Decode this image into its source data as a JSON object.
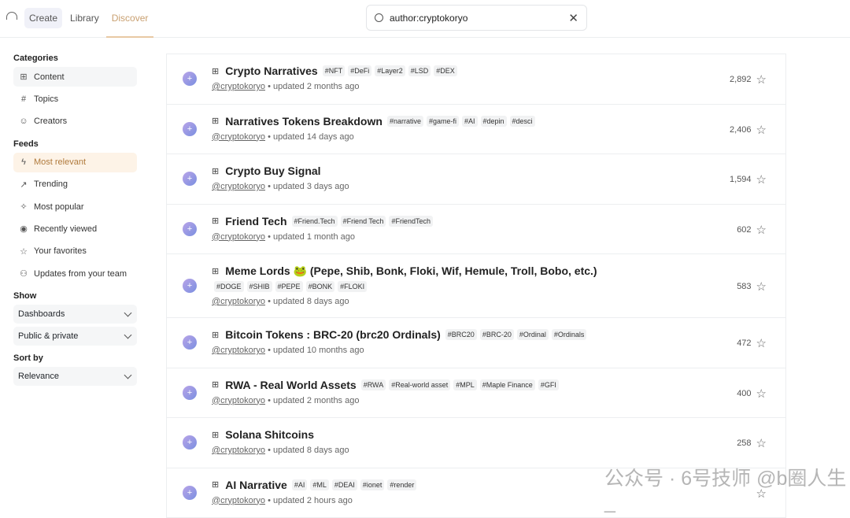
{
  "nav": {
    "tabs": [
      "Create",
      "Library",
      "Discover"
    ]
  },
  "search": {
    "value": "author:cryptokoryo"
  },
  "sidebar": {
    "categories_title": "Categories",
    "categories": [
      {
        "label": "Content",
        "icon": "grid-icon"
      },
      {
        "label": "Topics",
        "icon": "hash-icon"
      },
      {
        "label": "Creators",
        "icon": "user-icon"
      }
    ],
    "feeds_title": "Feeds",
    "feeds": [
      {
        "label": "Most relevant",
        "icon": "lightning-icon"
      },
      {
        "label": "Trending",
        "icon": "trend-icon"
      },
      {
        "label": "Most popular",
        "icon": "sparkle-icon"
      },
      {
        "label": "Recently viewed",
        "icon": "eye-icon"
      },
      {
        "label": "Your favorites",
        "icon": "star-icon"
      },
      {
        "label": "Updates from your team",
        "icon": "team-icon"
      }
    ],
    "show_title": "Show",
    "show": [
      "Dashboards",
      "Public & private"
    ],
    "sort_title": "Sort by",
    "sort": "Relevance"
  },
  "results": [
    {
      "name": "Crypto Narratives",
      "tags": [
        "#NFT",
        "#DeFi",
        "#Layer2",
        "#LSD",
        "#DEX"
      ],
      "author": "@cryptokoryo",
      "updated": " • updated 2 months ago",
      "count": "2,892"
    },
    {
      "name": "Narratives Tokens Breakdown",
      "tags": [
        "#narrative",
        "#game-fi",
        "#AI",
        "#depin",
        "#desci"
      ],
      "author": "@cryptokoryo",
      "updated": " • updated 14 days ago",
      "count": "2,406"
    },
    {
      "name": "Crypto Buy Signal",
      "tags": [],
      "author": "@cryptokoryo",
      "updated": " • updated 3 days ago",
      "count": "1,594"
    },
    {
      "name": "Friend Tech",
      "tags": [
        "#Friend.Tech",
        "#Friend Tech",
        "#FriendTech"
      ],
      "author": "@cryptokoryo",
      "updated": " • updated 1 month ago",
      "count": "602"
    },
    {
      "name": "Meme Lords 🐸 (Pepe, Shib, Bonk, Floki, Wif, Hemule, Troll, Bobo, etc.)",
      "tags2": [
        "#DOGE",
        "#SHIB",
        "#PEPE",
        "#BONK",
        "#FLOKI"
      ],
      "tags": [],
      "author": "@cryptokoryo",
      "updated": " • updated 8 days ago",
      "count": "583"
    },
    {
      "name": "Bitcoin Tokens : BRC-20 (brc20 Ordinals)",
      "tags": [
        "#BRC20",
        "#BRC-20",
        "#Ordinal",
        "#Ordinals"
      ],
      "author": "@cryptokoryo",
      "updated": " • updated 10 months ago",
      "count": "472"
    },
    {
      "name": "RWA - Real World Assets",
      "tags": [
        "#RWA",
        "#Real-world asset",
        "#MPL",
        "#Maple Finance",
        "#GFI"
      ],
      "author": "@cryptokoryo",
      "updated": " • updated 2 months ago",
      "count": "400"
    },
    {
      "name": "Solana Shitcoins",
      "tags": [],
      "author": "@cryptokoryo",
      "updated": " • updated 8 days ago",
      "count": "258"
    },
    {
      "name": "AI Narrative",
      "tags": [
        "#AI",
        "#ML",
        "#DEAI",
        "#ionet",
        "#render"
      ],
      "author": "@cryptokoryo",
      "updated": " • updated 2 hours ago",
      "count": ""
    }
  ],
  "watermark": "公众号 · 6号技师 @b圈人生_"
}
